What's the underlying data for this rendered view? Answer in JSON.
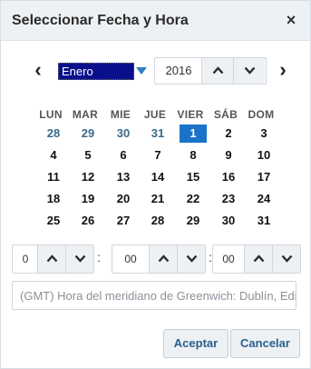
{
  "dialog": {
    "title": "Seleccionar Fecha y Hora",
    "close_label": "×"
  },
  "nav": {
    "prev_label": "‹",
    "next_label": "›",
    "month": "Enero",
    "year": "2016"
  },
  "weekdays": [
    "LUN",
    "MAR",
    "MIE",
    "JUE",
    "VIER",
    "SÁB",
    "DOM"
  ],
  "weeks": [
    [
      {
        "d": "28",
        "other": true
      },
      {
        "d": "29",
        "other": true
      },
      {
        "d": "30",
        "other": true
      },
      {
        "d": "31",
        "other": true
      },
      {
        "d": "1",
        "selected": true
      },
      {
        "d": "2"
      },
      {
        "d": "3"
      }
    ],
    [
      {
        "d": "4"
      },
      {
        "d": "5"
      },
      {
        "d": "6"
      },
      {
        "d": "7"
      },
      {
        "d": "8"
      },
      {
        "d": "9"
      },
      {
        "d": "10"
      }
    ],
    [
      {
        "d": "11"
      },
      {
        "d": "12"
      },
      {
        "d": "13"
      },
      {
        "d": "14"
      },
      {
        "d": "15"
      },
      {
        "d": "16"
      },
      {
        "d": "17"
      }
    ],
    [
      {
        "d": "18"
      },
      {
        "d": "19"
      },
      {
        "d": "20"
      },
      {
        "d": "21"
      },
      {
        "d": "22"
      },
      {
        "d": "23"
      },
      {
        "d": "24"
      }
    ],
    [
      {
        "d": "25"
      },
      {
        "d": "26"
      },
      {
        "d": "27"
      },
      {
        "d": "28"
      },
      {
        "d": "29"
      },
      {
        "d": "30"
      },
      {
        "d": "31"
      }
    ]
  ],
  "time": {
    "hour": "0",
    "minute": "00",
    "second": "00",
    "separator": ":"
  },
  "timezone": "(GMT) Hora del meridiano de Greenwich: Dublín, Edimburgo, Lisboa, Londres",
  "buttons": {
    "accept": "Aceptar",
    "cancel": "Cancelar"
  },
  "colors": {
    "selected_day": "#1a73c8",
    "month_highlight": "#0a0f8c",
    "other_month_day": "#3a6a8f",
    "button_text": "#2a5f8a"
  }
}
